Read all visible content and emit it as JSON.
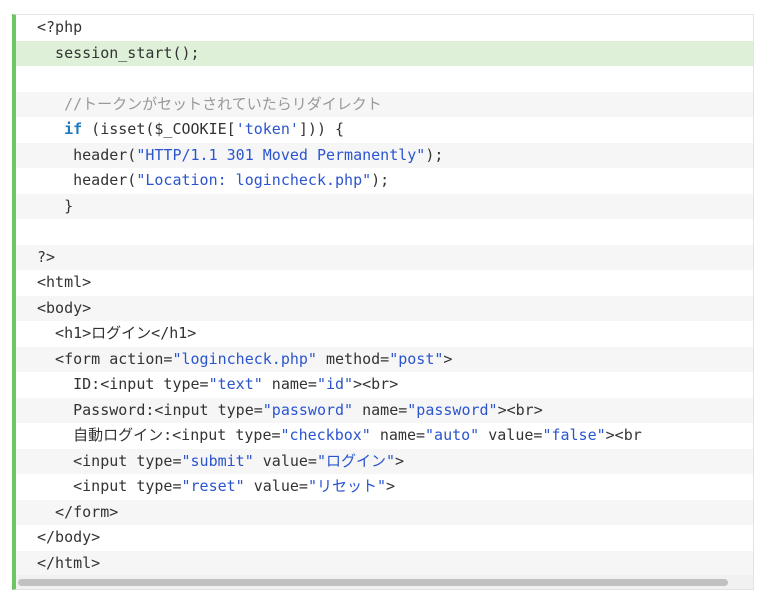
{
  "code": {
    "lines": [
      {
        "tokens": [
          {
            "t": "<?php",
            "c": "plain"
          }
        ]
      },
      {
        "tokens": [
          {
            "t": "  session_start();",
            "c": "plain"
          }
        ]
      },
      {
        "tokens": [
          {
            "t": "",
            "c": "plain"
          }
        ]
      },
      {
        "tokens": [
          {
            "t": "   //トークンがセットされていたらリダイレクト",
            "c": "comment"
          }
        ]
      },
      {
        "tokens": [
          {
            "t": "   ",
            "c": "plain"
          },
          {
            "t": "if",
            "c": "keyword"
          },
          {
            "t": " (isset($_COOKIE[",
            "c": "plain"
          },
          {
            "t": "'token'",
            "c": "string"
          },
          {
            "t": "])) {",
            "c": "plain"
          }
        ]
      },
      {
        "tokens": [
          {
            "t": "    header(",
            "c": "plain"
          },
          {
            "t": "\"HTTP/1.1 301 Moved Permanently\"",
            "c": "string"
          },
          {
            "t": ");",
            "c": "plain"
          }
        ]
      },
      {
        "tokens": [
          {
            "t": "    header(",
            "c": "plain"
          },
          {
            "t": "\"Location: logincheck.php\"",
            "c": "string"
          },
          {
            "t": ");",
            "c": "plain"
          }
        ]
      },
      {
        "tokens": [
          {
            "t": "   }",
            "c": "plain"
          }
        ]
      },
      {
        "tokens": [
          {
            "t": "",
            "c": "plain"
          }
        ]
      },
      {
        "tokens": [
          {
            "t": "?>",
            "c": "plain"
          }
        ]
      },
      {
        "tokens": [
          {
            "t": "<html>",
            "c": "plain"
          }
        ]
      },
      {
        "tokens": [
          {
            "t": "<body>",
            "c": "plain"
          }
        ]
      },
      {
        "tokens": [
          {
            "t": "  <h1>ログイン</h1>",
            "c": "plain"
          }
        ]
      },
      {
        "tokens": [
          {
            "t": "  <form action=",
            "c": "plain"
          },
          {
            "t": "\"logincheck.php\"",
            "c": "string"
          },
          {
            "t": " method=",
            "c": "plain"
          },
          {
            "t": "\"post\"",
            "c": "string"
          },
          {
            "t": ">",
            "c": "plain"
          }
        ]
      },
      {
        "tokens": [
          {
            "t": "    ID:<input type=",
            "c": "plain"
          },
          {
            "t": "\"text\"",
            "c": "string"
          },
          {
            "t": " name=",
            "c": "plain"
          },
          {
            "t": "\"id\"",
            "c": "string"
          },
          {
            "t": "><br>",
            "c": "plain"
          }
        ]
      },
      {
        "tokens": [
          {
            "t": "    Password:<input type=",
            "c": "plain"
          },
          {
            "t": "\"password\"",
            "c": "string"
          },
          {
            "t": " name=",
            "c": "plain"
          },
          {
            "t": "\"password\"",
            "c": "string"
          },
          {
            "t": "><br>",
            "c": "plain"
          }
        ]
      },
      {
        "tokens": [
          {
            "t": "    自動ログイン:<input type=",
            "c": "plain"
          },
          {
            "t": "\"checkbox\"",
            "c": "string"
          },
          {
            "t": " name=",
            "c": "plain"
          },
          {
            "t": "\"auto\"",
            "c": "string"
          },
          {
            "t": " value=",
            "c": "plain"
          },
          {
            "t": "\"false\"",
            "c": "string"
          },
          {
            "t": "><br",
            "c": "plain"
          }
        ]
      },
      {
        "tokens": [
          {
            "t": "    <input type=",
            "c": "plain"
          },
          {
            "t": "\"submit\"",
            "c": "string"
          },
          {
            "t": " value=",
            "c": "plain"
          },
          {
            "t": "\"ログイン\"",
            "c": "string"
          },
          {
            "t": ">",
            "c": "plain"
          }
        ]
      },
      {
        "tokens": [
          {
            "t": "    <input type=",
            "c": "plain"
          },
          {
            "t": "\"reset\"",
            "c": "string"
          },
          {
            "t": " value=",
            "c": "plain"
          },
          {
            "t": "\"リセット\"",
            "c": "string"
          },
          {
            "t": ">",
            "c": "plain"
          }
        ]
      },
      {
        "tokens": [
          {
            "t": "  </form>",
            "c": "plain"
          }
        ]
      },
      {
        "tokens": [
          {
            "t": "</body>",
            "c": "plain"
          }
        ]
      },
      {
        "tokens": [
          {
            "t": "</html>",
            "c": "plain"
          }
        ]
      }
    ],
    "highlighted_line": 1
  },
  "colors": {
    "accent_bar": "#6cc664",
    "highlight_bg": "#dff0d8",
    "string": "#2b55cf",
    "keyword": "#1e7bbf",
    "comment": "#999999"
  }
}
